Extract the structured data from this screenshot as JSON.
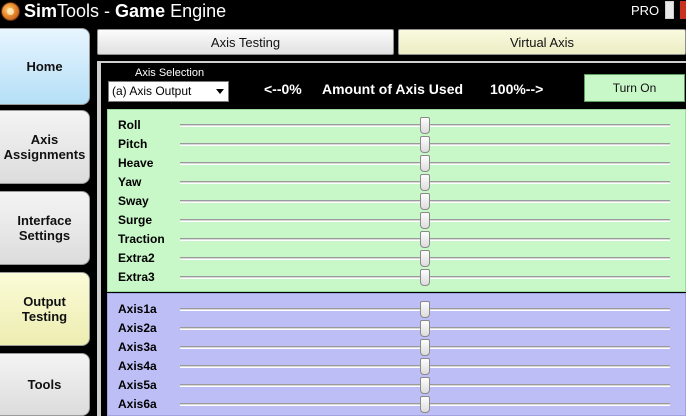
{
  "window": {
    "title_prefix": "Sim",
    "title_middle": "Tools - ",
    "title_bold": "Game",
    "title_suffix": " Engine",
    "edition": "PRO"
  },
  "sidebar": {
    "items": [
      {
        "label_line1": "Home",
        "label_line2": ""
      },
      {
        "label_line1": "Axis",
        "label_line2": "Assignments"
      },
      {
        "label_line1": "Interface",
        "label_line2": "Settings"
      },
      {
        "label_line1": "Output",
        "label_line2": "Testing"
      },
      {
        "label_line1": "Tools",
        "label_line2": ""
      }
    ]
  },
  "tabs": [
    "Axis Testing",
    "Virtual Axis"
  ],
  "axis_panel": {
    "selection_label": "Axis Selection",
    "selection_value": "(a) Axis Output",
    "min_label": "<--0%",
    "title": "Amount of Axis Used",
    "max_label": "100%-->",
    "turn_on_label": "Turn On"
  },
  "game_axes": [
    {
      "label": "Roll",
      "value": 50
    },
    {
      "label": "Pitch",
      "value": 50
    },
    {
      "label": "Heave",
      "value": 50
    },
    {
      "label": "Yaw",
      "value": 50
    },
    {
      "label": "Sway",
      "value": 50
    },
    {
      "label": "Surge",
      "value": 50
    },
    {
      "label": "Traction",
      "value": 50
    },
    {
      "label": "Extra2",
      "value": 50
    },
    {
      "label": "Extra3",
      "value": 50
    }
  ],
  "output_axes": [
    {
      "label": "Axis1a",
      "value": 50
    },
    {
      "label": "Axis2a",
      "value": 50
    },
    {
      "label": "Axis3a",
      "value": 50
    },
    {
      "label": "Axis4a",
      "value": 50
    },
    {
      "label": "Axis5a",
      "value": 50
    },
    {
      "label": "Axis6a",
      "value": 50
    }
  ],
  "colors": {
    "game_axis_bg": "#c8f7c8",
    "output_axis_bg": "#bebef7",
    "turn_on_bg": "#c8f7c8"
  }
}
